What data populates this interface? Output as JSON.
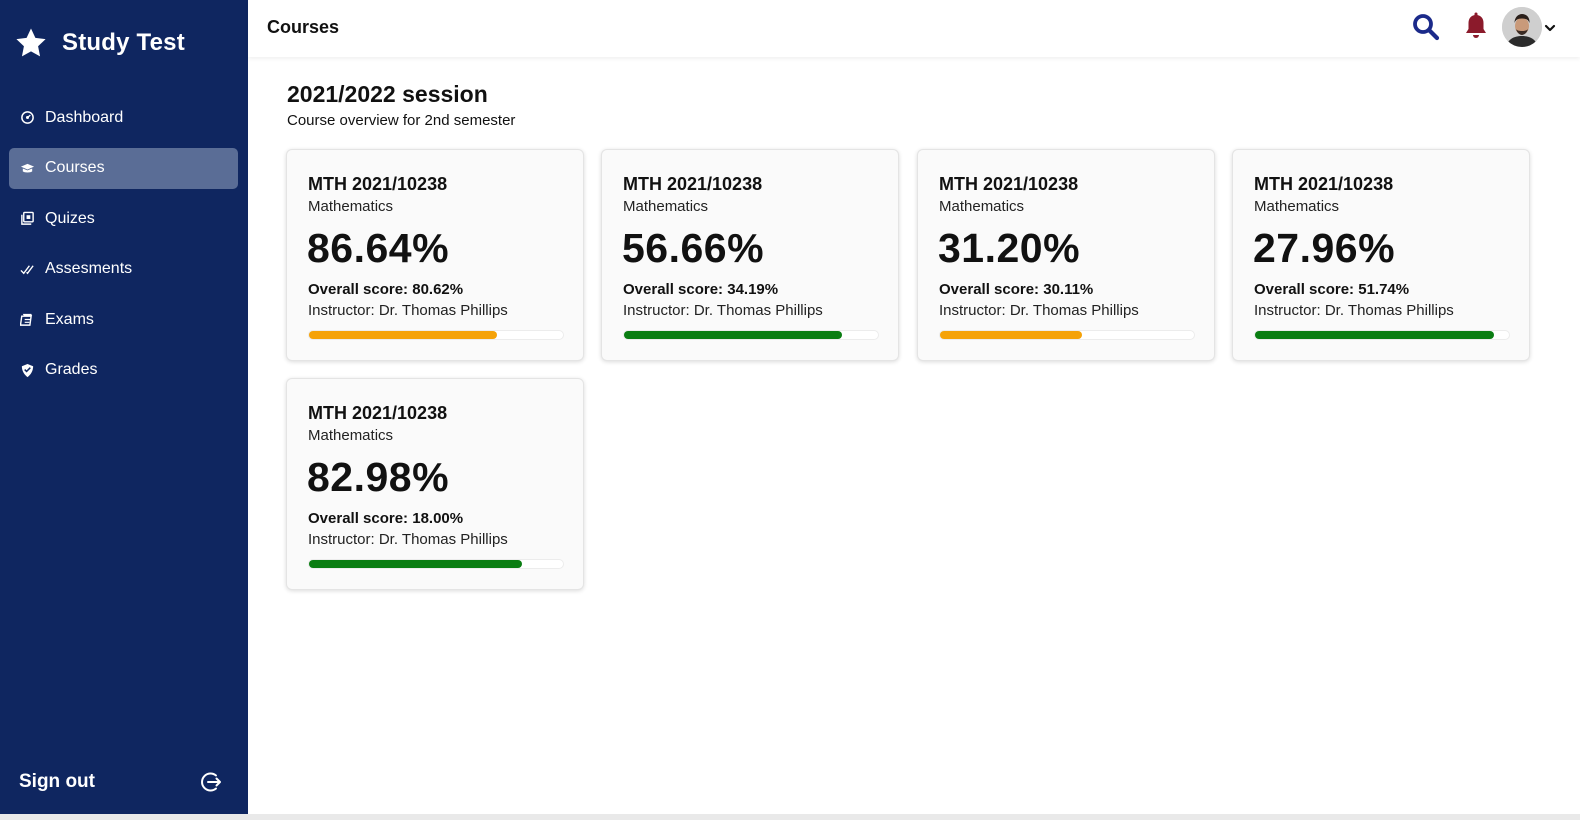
{
  "app": {
    "name": "Study Test"
  },
  "header": {
    "title": "Courses"
  },
  "sidebar": {
    "items": [
      {
        "label": "Dashboard",
        "icon": "dashboard-icon",
        "active": false
      },
      {
        "label": "Courses",
        "icon": "courses-icon",
        "active": true
      },
      {
        "label": "Quizes",
        "icon": "quiz-icon",
        "active": false
      },
      {
        "label": "Assesments",
        "icon": "check-double-icon",
        "active": false
      },
      {
        "label": "Exams",
        "icon": "exam-icon",
        "active": false
      },
      {
        "label": "Grades",
        "icon": "grade-shield-icon",
        "active": false
      }
    ],
    "signout_label": "Sign out"
  },
  "main": {
    "session_title": "2021/2022 session",
    "session_subtitle": "Course overview for 2nd semester",
    "cards": [
      {
        "code": "MTH 2021/10238",
        "subject": "Mathematics",
        "percent": "86.64%",
        "overall": "Overall score: 80.62%",
        "instructor": "Instructor: Dr. Thomas Phillips",
        "progress": 0.74,
        "bar_color": "#f5a208"
      },
      {
        "code": "MTH 2021/10238",
        "subject": "Mathematics",
        "percent": "56.66%",
        "overall": "Overall score: 34.19%",
        "instructor": "Instructor: Dr. Thomas Phillips",
        "progress": 0.86,
        "bar_color": "#0a7d12"
      },
      {
        "code": "MTH 2021/10238",
        "subject": "Mathematics",
        "percent": "31.20%",
        "overall": "Overall score: 30.11%",
        "instructor": "Instructor: Dr. Thomas Phillips",
        "progress": 0.56,
        "bar_color": "#f5a208"
      },
      {
        "code": "MTH 2021/10238",
        "subject": "Mathematics",
        "percent": "27.96%",
        "overall": "Overall score: 51.74%",
        "instructor": "Instructor: Dr. Thomas Phillips",
        "progress": 0.94,
        "bar_color": "#0a7d12"
      },
      {
        "code": "MTH 2021/10238",
        "subject": "Mathematics",
        "percent": "82.98%",
        "overall": "Overall score: 18.00%",
        "instructor": "Instructor: Dr. Thomas Phillips",
        "progress": 0.84,
        "bar_color": "#0a7d12"
      }
    ]
  },
  "colors": {
    "sidebar_bg": "#0f2660",
    "active_item_bg": "#5a6d96",
    "search_icon": "#1b2a8a",
    "bell_icon": "#8b1a2b",
    "progress_orange": "#f5a208",
    "progress_green": "#0a7d12"
  }
}
